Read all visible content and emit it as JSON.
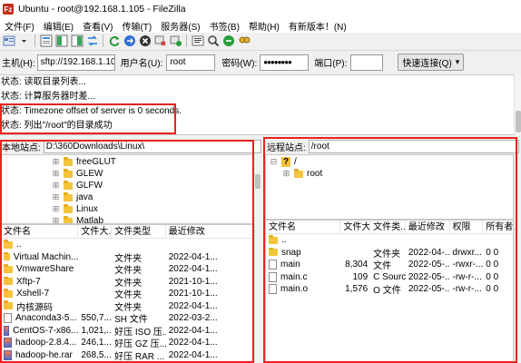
{
  "window": {
    "title": "Ubuntu - root@192.168.1.105 - FileZilla",
    "app_icon_text": "Fz"
  },
  "menu": [
    "文件(F)",
    "编辑(E)",
    "查看(V)",
    "传输(T)",
    "服务器(S)",
    "书签(B)",
    "帮助(H)",
    "有新版本！(N)"
  ],
  "toolbar_icons": [
    "site-manager-icon",
    "toggle-log-icon",
    "toggle-local-tree-icon",
    "toggle-remote-tree-icon",
    "toggle-queue-icon",
    "refresh-icon",
    "process-queue-icon",
    "cancel-icon",
    "disconnect-icon",
    "reconnect-icon",
    "filter-icon",
    "comparison-icon",
    "sync-browse-icon",
    "search-icon"
  ],
  "quickconnect": {
    "host_label": "主机(H):",
    "host_value": "sftp://192.168.1.10",
    "user_label": "用户名(U):",
    "user_value": "root",
    "password_label": "密码(W):",
    "password_value": "●●●●●●●●",
    "port_label": "端口(P):",
    "port_value": "",
    "connect_label": "快速连接(Q)",
    "dropdown_glyph": "▾"
  },
  "log": [
    "状态:  读取目录列表...",
    "状态:  计算服务器时差...",
    "状态:  Timezone offset of server is 0 seconds.",
    "状态:  列出\"/root\"的目录成功"
  ],
  "local": {
    "site_label": "本地站点:",
    "path": "D:\\360Downloads\\Linux\\",
    "tree": [
      "freeGLUT",
      "GLEW",
      "GLFW",
      "java",
      "Linux",
      "Matlab"
    ],
    "columns": [
      "文件名",
      "文件大...",
      "文件类型",
      "最近修改"
    ],
    "files": [
      {
        "name": "..",
        "size": "",
        "type": "",
        "modified": "",
        "icon": "folder"
      },
      {
        "name": "Virtual Machin...",
        "size": "",
        "type": "文件夹",
        "modified": "2022-04-1...",
        "icon": "folder"
      },
      {
        "name": "VmwareShare",
        "size": "",
        "type": "文件夹",
        "modified": "2022-04-1...",
        "icon": "folder"
      },
      {
        "name": "Xftp-7",
        "size": "",
        "type": "文件夹",
        "modified": "2021-10-1...",
        "icon": "folder"
      },
      {
        "name": "Xshell-7",
        "size": "",
        "type": "文件夹",
        "modified": "2021-10-1...",
        "icon": "folder"
      },
      {
        "name": "内核源码",
        "size": "",
        "type": "文件夹",
        "modified": "2022-04-1...",
        "icon": "folder"
      },
      {
        "name": "Anaconda3-5...",
        "size": "550,7...",
        "type": "SH 文件",
        "modified": "2022-03-2...",
        "icon": "file"
      },
      {
        "name": "CentOS-7-x86...",
        "size": "1,021,...",
        "type": "好压 ISO 压...",
        "modified": "2022-04-1...",
        "icon": "archive"
      },
      {
        "name": "hadoop-2.8.4...",
        "size": "246,1...",
        "type": "好压 GZ 压...",
        "modified": "2022-04-1...",
        "icon": "archive"
      },
      {
        "name": "hadoop-he.rar",
        "size": "268,5...",
        "type": "好压 RAR ...",
        "modified": "2022-04-1...",
        "icon": "archive"
      }
    ]
  },
  "remote": {
    "site_label": "远程站点:",
    "path": "/root",
    "tree_root": "/",
    "tree_root_badge": "?",
    "tree_child": "root",
    "columns": [
      "文件名",
      "文件大...",
      "文件类...",
      "最近修改",
      "权限",
      "所有者..."
    ],
    "files": [
      {
        "name": "..",
        "size": "",
        "type": "",
        "modified": "",
        "perms": "",
        "owner": "",
        "icon": "folder"
      },
      {
        "name": "snap",
        "size": "",
        "type": "文件夹",
        "modified": "2022-04-...",
        "perms": "drwxr...",
        "owner": "0 0",
        "icon": "folder"
      },
      {
        "name": "main",
        "size": "8,304",
        "type": "文件",
        "modified": "2022-05-...",
        "perms": "-rwxr-...",
        "owner": "0 0",
        "icon": "file"
      },
      {
        "name": "main.c",
        "size": "109",
        "type": "C Sourc...",
        "modified": "2022-05-...",
        "perms": "-rw-r-...",
        "owner": "0 0",
        "icon": "file"
      },
      {
        "name": "main.o",
        "size": "1,576",
        "type": "O 文件",
        "modified": "2022-05-...",
        "perms": "-rw-r-...",
        "owner": "0 0",
        "icon": "file"
      }
    ]
  },
  "colors": {
    "highlight": "#e8231e",
    "folder": "#f4c43b"
  }
}
